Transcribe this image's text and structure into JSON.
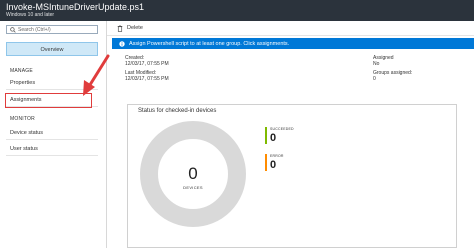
{
  "header": {
    "title": "Invoke-MSIntuneDriverUpdate.ps1",
    "subtitle": "Windows 10 and later"
  },
  "sidebar": {
    "search_placeholder": "Search (Ctrl+/)",
    "overview_label": "Overview",
    "manage_section": "MANAGE",
    "properties_label": "Properties",
    "assignments_label": "Assignments",
    "monitor_section": "MONITOR",
    "device_status_label": "Device status",
    "user_status_label": "User status"
  },
  "toolbar": {
    "delete_label": "Delete"
  },
  "banner": {
    "text": "Assign Powershell script to at least one group. Click assignments."
  },
  "details": {
    "created_label": "Created:",
    "created_value": "12/03/17, 07:55 PM",
    "modified_label": "Last Modified:",
    "modified_value": "12/03/17, 07:55 PM",
    "assigned_label": "Assigned",
    "assigned_value": "No",
    "groups_label": "Groups assigned:",
    "groups_value": "0"
  },
  "status_panel": {
    "title": "Status for checked-in devices",
    "total": "0",
    "total_label": "DEVICES",
    "succeeded_label": "SUCCEEDED",
    "succeeded_value": "0",
    "error_label": "ERROR",
    "error_value": "0"
  },
  "colors": {
    "header_bg": "#2b333c",
    "banner_bg": "#0078d7",
    "succeeded": "#7fba00",
    "error": "#ff8c00",
    "donut": "#d9d9d9",
    "highlight": "#e03c3c"
  }
}
